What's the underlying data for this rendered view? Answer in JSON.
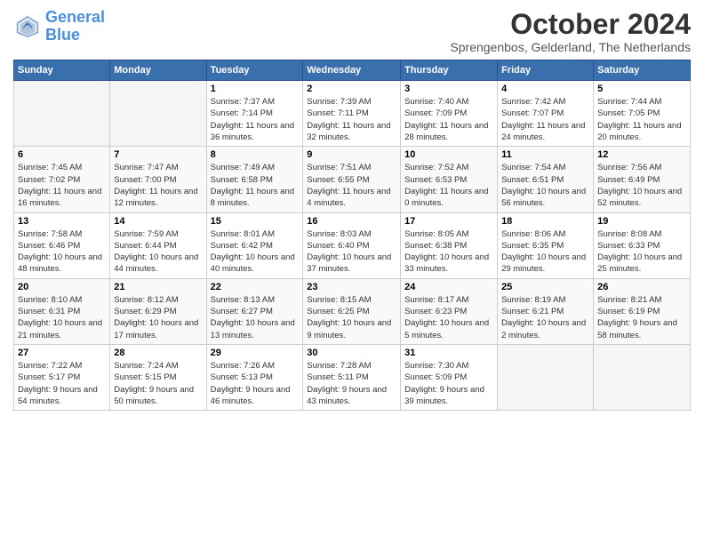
{
  "logo": {
    "line1": "General",
    "line2": "Blue"
  },
  "title": "October 2024",
  "location": "Sprengenbos, Gelderland, The Netherlands",
  "days_header": [
    "Sunday",
    "Monday",
    "Tuesday",
    "Wednesday",
    "Thursday",
    "Friday",
    "Saturday"
  ],
  "weeks": [
    [
      {
        "num": "",
        "empty": true
      },
      {
        "num": "",
        "empty": true
      },
      {
        "num": "1",
        "sunrise": "7:37 AM",
        "sunset": "7:14 PM",
        "daylight": "11 hours and 36 minutes."
      },
      {
        "num": "2",
        "sunrise": "7:39 AM",
        "sunset": "7:11 PM",
        "daylight": "11 hours and 32 minutes."
      },
      {
        "num": "3",
        "sunrise": "7:40 AM",
        "sunset": "7:09 PM",
        "daylight": "11 hours and 28 minutes."
      },
      {
        "num": "4",
        "sunrise": "7:42 AM",
        "sunset": "7:07 PM",
        "daylight": "11 hours and 24 minutes."
      },
      {
        "num": "5",
        "sunrise": "7:44 AM",
        "sunset": "7:05 PM",
        "daylight": "11 hours and 20 minutes."
      }
    ],
    [
      {
        "num": "6",
        "sunrise": "7:45 AM",
        "sunset": "7:02 PM",
        "daylight": "11 hours and 16 minutes."
      },
      {
        "num": "7",
        "sunrise": "7:47 AM",
        "sunset": "7:00 PM",
        "daylight": "11 hours and 12 minutes."
      },
      {
        "num": "8",
        "sunrise": "7:49 AM",
        "sunset": "6:58 PM",
        "daylight": "11 hours and 8 minutes."
      },
      {
        "num": "9",
        "sunrise": "7:51 AM",
        "sunset": "6:55 PM",
        "daylight": "11 hours and 4 minutes."
      },
      {
        "num": "10",
        "sunrise": "7:52 AM",
        "sunset": "6:53 PM",
        "daylight": "11 hours and 0 minutes."
      },
      {
        "num": "11",
        "sunrise": "7:54 AM",
        "sunset": "6:51 PM",
        "daylight": "10 hours and 56 minutes."
      },
      {
        "num": "12",
        "sunrise": "7:56 AM",
        "sunset": "6:49 PM",
        "daylight": "10 hours and 52 minutes."
      }
    ],
    [
      {
        "num": "13",
        "sunrise": "7:58 AM",
        "sunset": "6:46 PM",
        "daylight": "10 hours and 48 minutes."
      },
      {
        "num": "14",
        "sunrise": "7:59 AM",
        "sunset": "6:44 PM",
        "daylight": "10 hours and 44 minutes."
      },
      {
        "num": "15",
        "sunrise": "8:01 AM",
        "sunset": "6:42 PM",
        "daylight": "10 hours and 40 minutes."
      },
      {
        "num": "16",
        "sunrise": "8:03 AM",
        "sunset": "6:40 PM",
        "daylight": "10 hours and 37 minutes."
      },
      {
        "num": "17",
        "sunrise": "8:05 AM",
        "sunset": "6:38 PM",
        "daylight": "10 hours and 33 minutes."
      },
      {
        "num": "18",
        "sunrise": "8:06 AM",
        "sunset": "6:35 PM",
        "daylight": "10 hours and 29 minutes."
      },
      {
        "num": "19",
        "sunrise": "8:08 AM",
        "sunset": "6:33 PM",
        "daylight": "10 hours and 25 minutes."
      }
    ],
    [
      {
        "num": "20",
        "sunrise": "8:10 AM",
        "sunset": "6:31 PM",
        "daylight": "10 hours and 21 minutes."
      },
      {
        "num": "21",
        "sunrise": "8:12 AM",
        "sunset": "6:29 PM",
        "daylight": "10 hours and 17 minutes."
      },
      {
        "num": "22",
        "sunrise": "8:13 AM",
        "sunset": "6:27 PM",
        "daylight": "10 hours and 13 minutes."
      },
      {
        "num": "23",
        "sunrise": "8:15 AM",
        "sunset": "6:25 PM",
        "daylight": "10 hours and 9 minutes."
      },
      {
        "num": "24",
        "sunrise": "8:17 AM",
        "sunset": "6:23 PM",
        "daylight": "10 hours and 5 minutes."
      },
      {
        "num": "25",
        "sunrise": "8:19 AM",
        "sunset": "6:21 PM",
        "daylight": "10 hours and 2 minutes."
      },
      {
        "num": "26",
        "sunrise": "8:21 AM",
        "sunset": "6:19 PM",
        "daylight": "9 hours and 58 minutes."
      }
    ],
    [
      {
        "num": "27",
        "sunrise": "7:22 AM",
        "sunset": "5:17 PM",
        "daylight": "9 hours and 54 minutes."
      },
      {
        "num": "28",
        "sunrise": "7:24 AM",
        "sunset": "5:15 PM",
        "daylight": "9 hours and 50 minutes."
      },
      {
        "num": "29",
        "sunrise": "7:26 AM",
        "sunset": "5:13 PM",
        "daylight": "9 hours and 46 minutes."
      },
      {
        "num": "30",
        "sunrise": "7:28 AM",
        "sunset": "5:11 PM",
        "daylight": "9 hours and 43 minutes."
      },
      {
        "num": "31",
        "sunrise": "7:30 AM",
        "sunset": "5:09 PM",
        "daylight": "9 hours and 39 minutes."
      },
      {
        "num": "",
        "empty": true
      },
      {
        "num": "",
        "empty": true
      }
    ]
  ]
}
